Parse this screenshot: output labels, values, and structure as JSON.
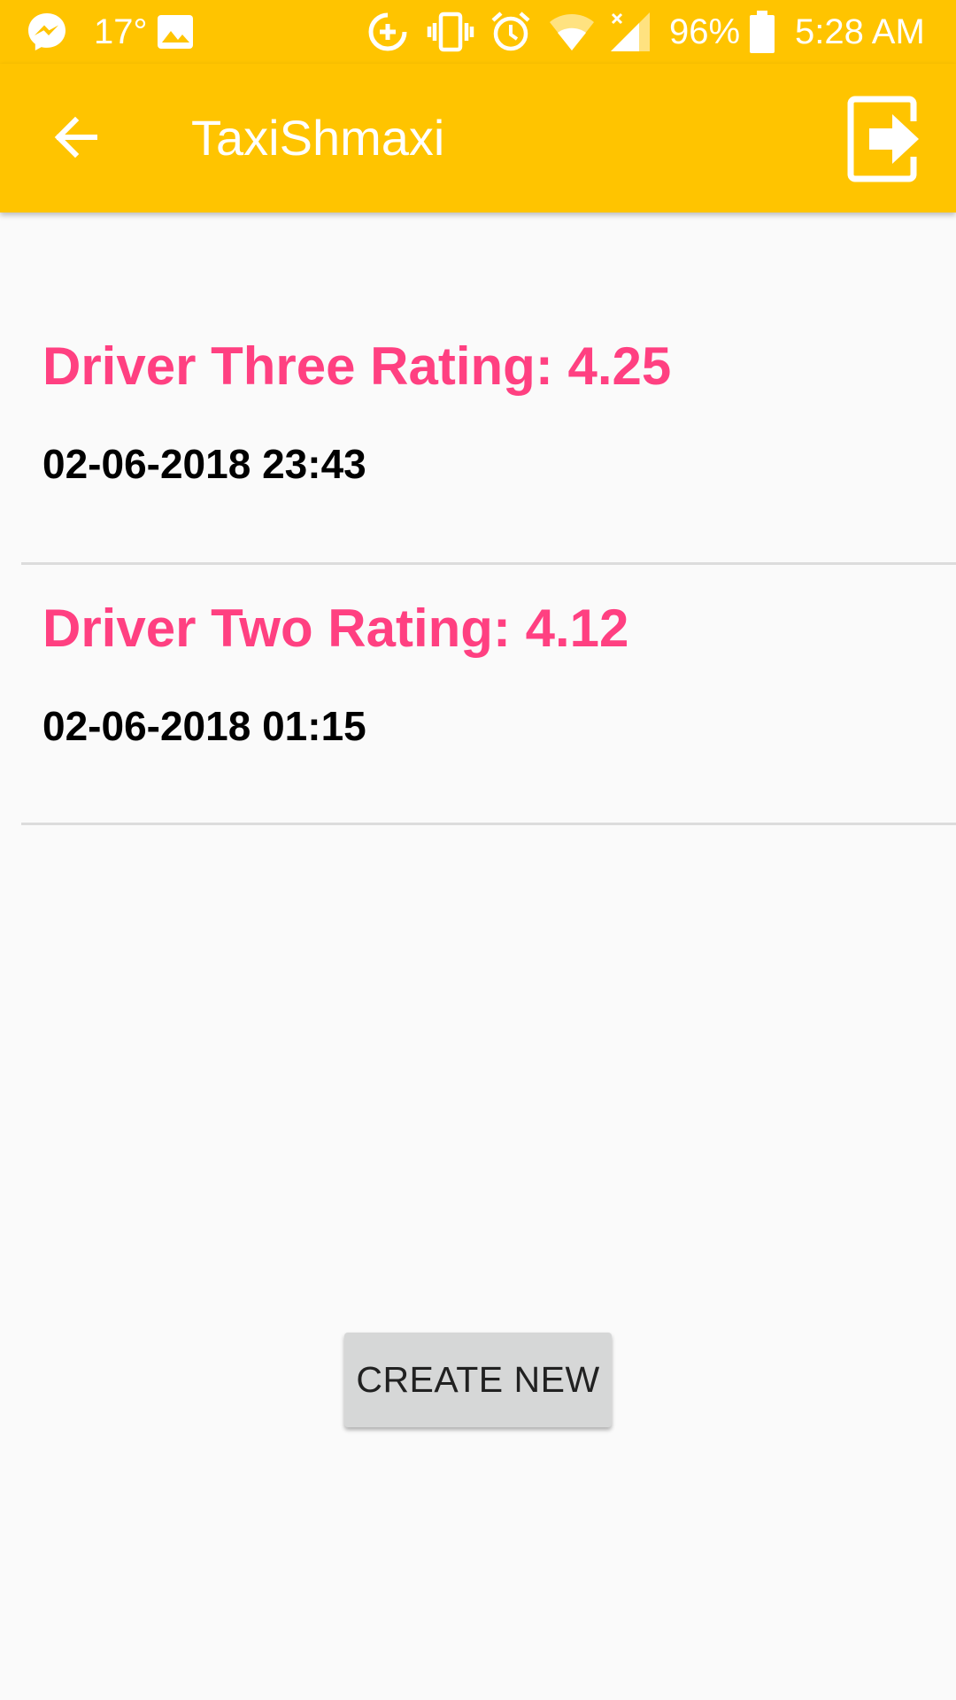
{
  "status_bar": {
    "temperature": "17°",
    "battery": "96%",
    "time": "5:28 AM",
    "icons": [
      "messenger-icon",
      "image-icon",
      "data-saver-icon",
      "vibrate-icon",
      "alarm-icon",
      "wifi-icon",
      "signal-icon",
      "battery-icon"
    ]
  },
  "app_bar": {
    "title": "TaxiShmaxi",
    "back_icon": "arrow-back-icon",
    "logout_icon": "logout-icon"
  },
  "rides": [
    {
      "title": "Driver Three Rating: 4.25",
      "date": "02-06-2018 23:43"
    },
    {
      "title": "Driver Two Rating: 4.12",
      "date": "02-06-2018 01:15"
    }
  ],
  "actions": {
    "create_label": "CREATE NEW"
  },
  "colors": {
    "primary": "#ffc400",
    "accent": "#ff4081",
    "background": "#fafafa",
    "button": "#d6d7d7"
  }
}
